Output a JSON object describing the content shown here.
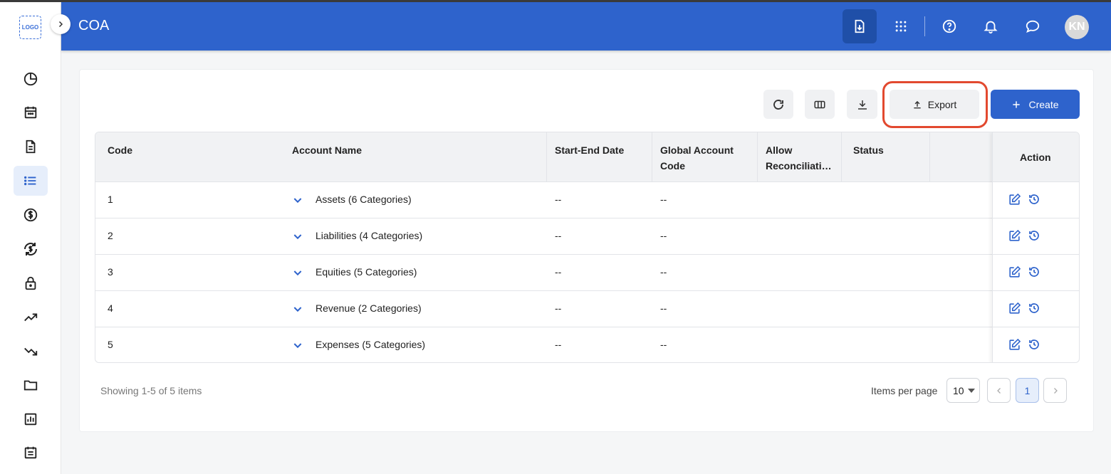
{
  "logo": {
    "text": "LOGO"
  },
  "header": {
    "title": "COA",
    "avatar_initials": "KN"
  },
  "sidebar": {
    "icons": [
      "dashboard-pie-icon",
      "calendar-icon",
      "document-icon",
      "list-icon",
      "dollar-icon",
      "currency-exchange-icon",
      "lock-icon",
      "trending-up-icon",
      "trending-down-icon",
      "folder-icon",
      "report-chart-icon",
      "journal-icon"
    ],
    "active": "list-icon"
  },
  "header_icons": [
    "file-download-icon",
    "apps-grid-icon",
    "help-icon",
    "bell-icon",
    "chat-icon"
  ],
  "toolbar": {
    "export_label": "Export",
    "create_label": "Create"
  },
  "table": {
    "headers": {
      "code": "Code",
      "account_name": "Account Name",
      "start_end_date": "Start-End Date",
      "global_account_code_1": "Global Account",
      "global_account_code_2": "Code",
      "allow_reconciliation_1": "Allow",
      "allow_reconciliation_2": "Reconciliati…",
      "status": "Status",
      "action": "Action"
    },
    "rows": [
      {
        "code": "1",
        "account_name": "Assets (6 Categories)",
        "start_end_date": "--",
        "global_account_code": "--"
      },
      {
        "code": "2",
        "account_name": "Liabilities (4 Categories)",
        "start_end_date": "--",
        "global_account_code": "--"
      },
      {
        "code": "3",
        "account_name": "Equities (5 Categories)",
        "start_end_date": "--",
        "global_account_code": "--"
      },
      {
        "code": "4",
        "account_name": "Revenue (2 Categories)",
        "start_end_date": "--",
        "global_account_code": "--"
      },
      {
        "code": "5",
        "account_name": "Expenses (5 Categories)",
        "start_end_date": "--",
        "global_account_code": "--"
      }
    ]
  },
  "footer": {
    "showing_text": "Showing 1-5 of 5 items",
    "items_per_page_label": "Items per page",
    "items_per_page_value": "10",
    "current_page": "1"
  },
  "colors": {
    "header_bg": "#2e63cc",
    "accent": "#2e63cc",
    "highlight": "#e2492f"
  }
}
